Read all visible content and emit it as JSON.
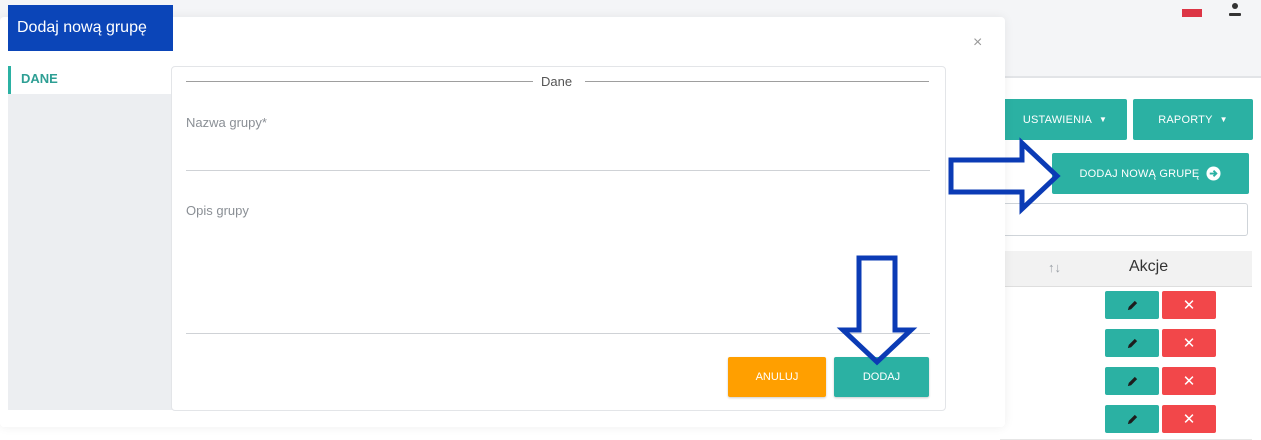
{
  "header": {
    "menu": [
      {
        "label": "USTAWIENIA",
        "caret": "▼"
      },
      {
        "label": "RAPORTY",
        "caret": "▼"
      }
    ],
    "add_group_button": "DODAJ NOWĄ GRUPĘ",
    "icons": [
      "flag-icon",
      "user-icon",
      "arrow-circle-right-icon"
    ]
  },
  "table": {
    "sort_icon": "↑↓",
    "actions_header": "Akcje",
    "row_count_visible": 4,
    "edit_icon": "pencil-icon",
    "delete_icon": "close-icon",
    "delete_glyph": "✕"
  },
  "modal": {
    "title": "Dodaj nową grupę",
    "close_glyph": "×",
    "tabs": [
      {
        "label": "DANE"
      }
    ],
    "legend": "Dane",
    "fields": {
      "name_label": "Nazwa grupy*",
      "description_label": "Opis grupy"
    },
    "buttons": {
      "cancel": "ANULUJ",
      "add": "DODAJ"
    }
  },
  "colors": {
    "accent": "#2bb1a3",
    "title_bg": "#0b45b8",
    "cancel": "#ff9f00",
    "delete": "#f2474a",
    "annotation_arrow": "#0b3bb5"
  }
}
